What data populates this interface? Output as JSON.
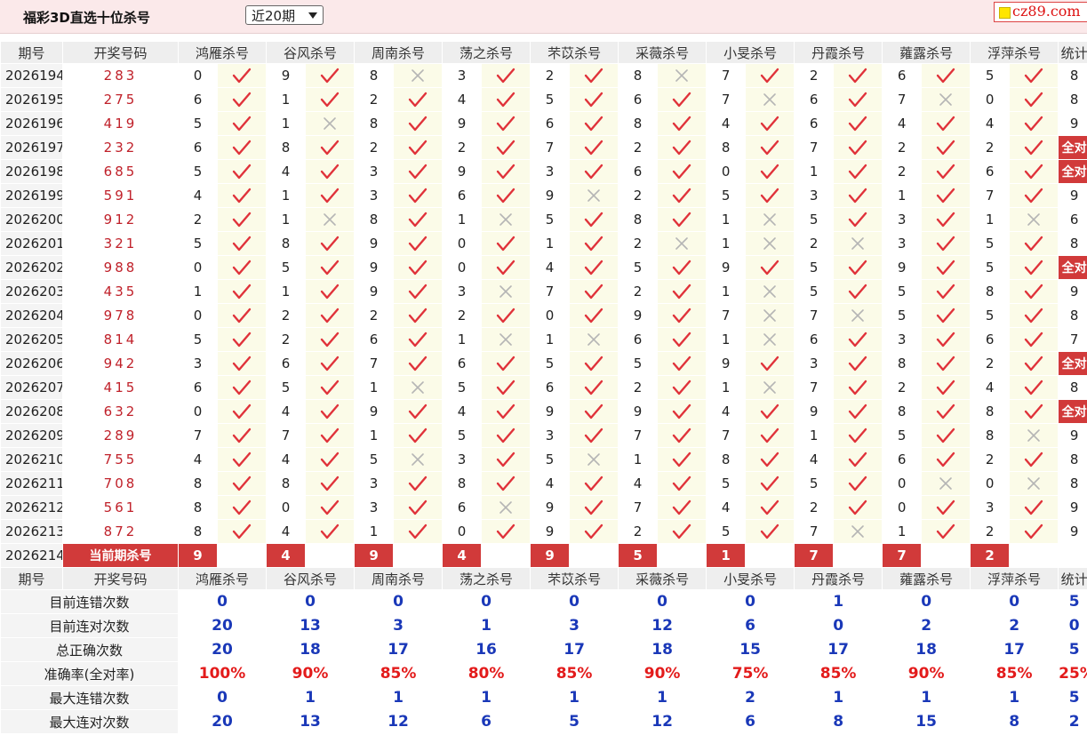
{
  "header": {
    "title": "福彩3D直选十位杀号",
    "period_select": "近20期",
    "logo_text": "cz89.com"
  },
  "columns": {
    "period": "期号",
    "draw": "开奖号码",
    "experts": [
      "鸿雁杀号",
      "谷风杀号",
      "周南杀号",
      "荡之杀号",
      "芣苡杀号",
      "采薇杀号",
      "小旻杀号",
      "丹霞杀号",
      "蕹露杀号",
      "浮萍杀号"
    ],
    "stat": "统计"
  },
  "rows": [
    {
      "period": "2026194",
      "draw": "283",
      "kills": [
        0,
        9,
        8,
        3,
        2,
        8,
        7,
        2,
        6,
        5
      ],
      "ok": [
        1,
        1,
        0,
        1,
        1,
        0,
        1,
        1,
        1,
        1
      ],
      "stat": "8"
    },
    {
      "period": "2026195",
      "draw": "275",
      "kills": [
        6,
        1,
        2,
        4,
        5,
        6,
        7,
        6,
        7,
        0
      ],
      "ok": [
        1,
        1,
        1,
        1,
        1,
        1,
        0,
        1,
        0,
        1
      ],
      "stat": "8"
    },
    {
      "period": "2026196",
      "draw": "419",
      "kills": [
        5,
        1,
        8,
        9,
        6,
        8,
        4,
        6,
        4,
        4
      ],
      "ok": [
        1,
        0,
        1,
        1,
        1,
        1,
        1,
        1,
        1,
        1
      ],
      "stat": "9"
    },
    {
      "period": "2026197",
      "draw": "232",
      "kills": [
        6,
        8,
        2,
        2,
        7,
        2,
        8,
        7,
        2,
        2
      ],
      "ok": [
        1,
        1,
        1,
        1,
        1,
        1,
        1,
        1,
        1,
        1
      ],
      "stat": "全对"
    },
    {
      "period": "2026198",
      "draw": "685",
      "kills": [
        5,
        4,
        3,
        9,
        3,
        6,
        0,
        1,
        2,
        6
      ],
      "ok": [
        1,
        1,
        1,
        1,
        1,
        1,
        1,
        1,
        1,
        1
      ],
      "stat": "全对"
    },
    {
      "period": "2026199",
      "draw": "591",
      "kills": [
        4,
        1,
        3,
        6,
        9,
        2,
        5,
        3,
        1,
        7
      ],
      "ok": [
        1,
        1,
        1,
        1,
        0,
        1,
        1,
        1,
        1,
        1
      ],
      "stat": "9"
    },
    {
      "period": "2026200",
      "draw": "912",
      "kills": [
        2,
        1,
        8,
        1,
        5,
        8,
        1,
        5,
        3,
        1
      ],
      "ok": [
        1,
        0,
        1,
        0,
        1,
        1,
        0,
        1,
        1,
        0
      ],
      "stat": "6"
    },
    {
      "period": "2026201",
      "draw": "321",
      "kills": [
        5,
        8,
        9,
        0,
        1,
        2,
        1,
        2,
        3,
        5
      ],
      "ok": [
        1,
        1,
        1,
        1,
        1,
        0,
        0,
        0,
        1,
        1
      ],
      "stat": "8"
    },
    {
      "period": "2026202",
      "draw": "988",
      "kills": [
        0,
        5,
        9,
        0,
        4,
        5,
        9,
        5,
        9,
        5
      ],
      "ok": [
        1,
        1,
        1,
        1,
        1,
        1,
        1,
        1,
        1,
        1
      ],
      "stat": "全对"
    },
    {
      "period": "2026203",
      "draw": "435",
      "kills": [
        1,
        1,
        9,
        3,
        7,
        2,
        1,
        5,
        5,
        8
      ],
      "ok": [
        1,
        1,
        1,
        0,
        1,
        1,
        0,
        1,
        1,
        1
      ],
      "stat": "9"
    },
    {
      "period": "2026204",
      "draw": "978",
      "kills": [
        0,
        2,
        2,
        2,
        0,
        9,
        7,
        7,
        5,
        5
      ],
      "ok": [
        1,
        1,
        1,
        1,
        1,
        1,
        0,
        0,
        1,
        1
      ],
      "stat": "8"
    },
    {
      "period": "2026205",
      "draw": "814",
      "kills": [
        5,
        2,
        6,
        1,
        1,
        6,
        1,
        6,
        3,
        6
      ],
      "ok": [
        1,
        1,
        1,
        0,
        0,
        1,
        0,
        1,
        1,
        1
      ],
      "stat": "7"
    },
    {
      "period": "2026206",
      "draw": "942",
      "kills": [
        3,
        6,
        7,
        6,
        5,
        5,
        9,
        3,
        8,
        2
      ],
      "ok": [
        1,
        1,
        1,
        1,
        1,
        1,
        1,
        1,
        1,
        1
      ],
      "stat": "全对"
    },
    {
      "period": "2026207",
      "draw": "415",
      "kills": [
        6,
        5,
        1,
        5,
        6,
        2,
        1,
        7,
        2,
        4
      ],
      "ok": [
        1,
        1,
        0,
        1,
        1,
        1,
        0,
        1,
        1,
        1
      ],
      "stat": "8"
    },
    {
      "period": "2026208",
      "draw": "632",
      "kills": [
        0,
        4,
        9,
        4,
        9,
        9,
        4,
        9,
        8,
        8
      ],
      "ok": [
        1,
        1,
        1,
        1,
        1,
        1,
        1,
        1,
        1,
        1
      ],
      "stat": "全对"
    },
    {
      "period": "2026209",
      "draw": "289",
      "kills": [
        7,
        7,
        1,
        5,
        3,
        7,
        7,
        1,
        5,
        8
      ],
      "ok": [
        1,
        1,
        1,
        1,
        1,
        1,
        1,
        1,
        1,
        0
      ],
      "stat": "9"
    },
    {
      "period": "2026210",
      "draw": "755",
      "kills": [
        4,
        4,
        5,
        3,
        5,
        1,
        8,
        4,
        6,
        2
      ],
      "ok": [
        1,
        1,
        0,
        1,
        0,
        1,
        1,
        1,
        1,
        1
      ],
      "stat": "8"
    },
    {
      "period": "2026211",
      "draw": "708",
      "kills": [
        8,
        8,
        3,
        8,
        4,
        4,
        5,
        5,
        0,
        0
      ],
      "ok": [
        1,
        1,
        1,
        1,
        1,
        1,
        1,
        1,
        0,
        0
      ],
      "stat": "8"
    },
    {
      "period": "2026212",
      "draw": "561",
      "kills": [
        8,
        0,
        3,
        6,
        9,
        7,
        4,
        2,
        0,
        3
      ],
      "ok": [
        1,
        1,
        1,
        0,
        1,
        1,
        1,
        1,
        1,
        1
      ],
      "stat": "9"
    },
    {
      "period": "2026213",
      "draw": "872",
      "kills": [
        8,
        4,
        1,
        0,
        9,
        2,
        5,
        7,
        1,
        2
      ],
      "ok": [
        1,
        1,
        1,
        1,
        1,
        1,
        1,
        0,
        1,
        1
      ],
      "stat": "9"
    }
  ],
  "current": {
    "period": "2026214",
    "label": "当前期杀号",
    "kills": [
      "9",
      "4",
      "9",
      "4",
      "9",
      "5",
      "1",
      "7",
      "7",
      "2"
    ]
  },
  "summary": {
    "rows": [
      {
        "label": "目前连错次数",
        "values": [
          "0",
          "0",
          "0",
          "0",
          "0",
          "0",
          "0",
          "1",
          "0",
          "0"
        ],
        "stat": "5",
        "red": false
      },
      {
        "label": "目前连对次数",
        "values": [
          "20",
          "13",
          "3",
          "1",
          "3",
          "12",
          "6",
          "0",
          "2",
          "2"
        ],
        "stat": "0",
        "red": false
      },
      {
        "label": "总正确次数",
        "values": [
          "20",
          "18",
          "17",
          "16",
          "17",
          "18",
          "15",
          "17",
          "18",
          "17"
        ],
        "stat": "5",
        "red": false
      },
      {
        "label": "准确率(全对率)",
        "values": [
          "100%",
          "90%",
          "85%",
          "80%",
          "85%",
          "90%",
          "75%",
          "85%",
          "90%",
          "85%"
        ],
        "stat": "25%",
        "red": true
      },
      {
        "label": "最大连错次数",
        "values": [
          "0",
          "1",
          "1",
          "1",
          "1",
          "1",
          "2",
          "1",
          "1",
          "1"
        ],
        "stat": "5",
        "red": false
      },
      {
        "label": "最大连对次数",
        "values": [
          "20",
          "13",
          "12",
          "6",
          "5",
          "12",
          "6",
          "8",
          "15",
          "8"
        ],
        "stat": "2",
        "red": false
      }
    ]
  },
  "colors": {
    "accent_red": "#d13a3a",
    "check_red": "#e0323a",
    "cross_gray": "#b5b5b5",
    "summary_blue": "#1a38b8"
  }
}
